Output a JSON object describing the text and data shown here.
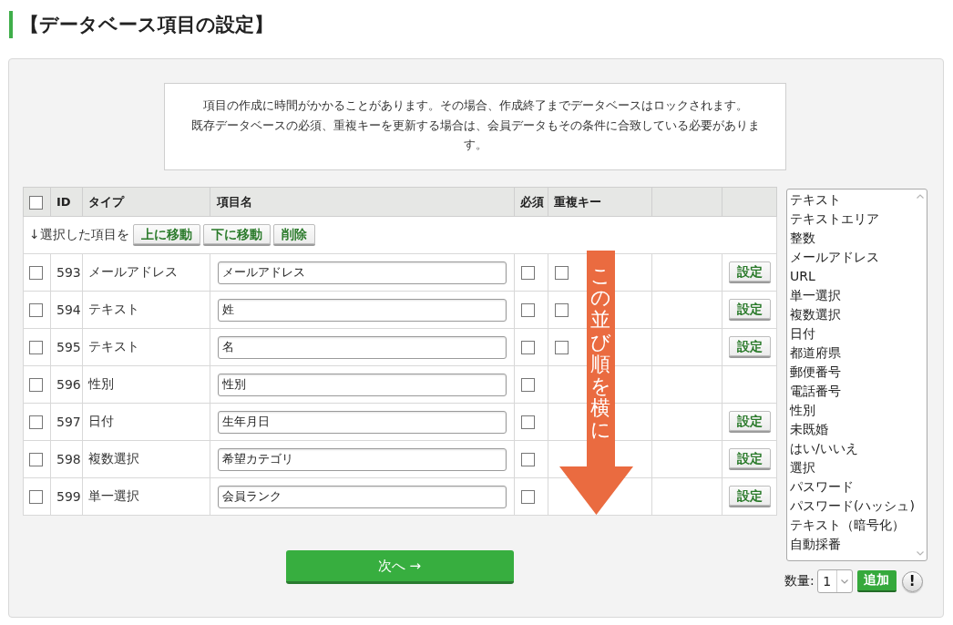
{
  "page_title": "【データベース項目の設定】",
  "notice": {
    "paragraphs": [
      "項目の作成に時間がかかることがあります。その場合、作成終了までデータベースはロックされます。",
      "既存データベースの必須、重複キーを更新する場合は、会員データもその条件に合致している必要があります。"
    ]
  },
  "table": {
    "select_all": {
      "checked": false
    },
    "columns": [
      "ID",
      "タイプ",
      "項目名",
      "必須",
      "重複キー"
    ],
    "bulk_action": {
      "label": "↓選択した項目を",
      "buttons": [
        "上に移動",
        "下に移動",
        "削除"
      ]
    },
    "rows": [
      {
        "checked": false,
        "id": "593",
        "type": "メールアドレス",
        "name": "メールアドレス",
        "required": false,
        "unique_key": false,
        "settings_button": "設定"
      },
      {
        "checked": false,
        "id": "594",
        "type": "テキスト",
        "name": "姓",
        "required": false,
        "unique_key": false,
        "settings_button": "設定"
      },
      {
        "checked": false,
        "id": "595",
        "type": "テキスト",
        "name": "名",
        "required": false,
        "unique_key": false,
        "settings_button": "設定"
      },
      {
        "checked": false,
        "id": "596",
        "type": "性別",
        "name": "性別",
        "required": false
      },
      {
        "checked": false,
        "id": "597",
        "type": "日付",
        "name": "生年月日",
        "required": false,
        "settings_button": "設定"
      },
      {
        "checked": false,
        "id": "598",
        "type": "複数選択",
        "name": "希望カテゴリ",
        "required": false,
        "settings_button": "設定"
      },
      {
        "checked": false,
        "id": "599",
        "type": "単一選択",
        "name": "会員ランク",
        "required": false,
        "settings_button": "設定"
      }
    ]
  },
  "annotation": {
    "text": "この並び順を横に"
  },
  "next_button": "次へ →",
  "type_list": {
    "items": [
      {
        "label": "テキスト",
        "selected": false
      },
      {
        "label": "テキストエリア",
        "selected": false
      },
      {
        "label": "整数",
        "selected": false
      },
      {
        "label": "メールアドレス",
        "selected": false
      },
      {
        "label": "URL",
        "selected": false
      },
      {
        "label": "単一選択",
        "selected": false
      },
      {
        "label": "複数選択",
        "selected": false
      },
      {
        "label": "日付",
        "selected": false
      },
      {
        "label": "都道府県",
        "selected": false
      },
      {
        "label": "郵便番号",
        "selected": false
      },
      {
        "label": "電話番号",
        "selected": false
      },
      {
        "label": "性別",
        "selected": false
      },
      {
        "label": "未既婚",
        "selected": false
      },
      {
        "label": "はい/いいえ",
        "selected": false
      },
      {
        "label": "選択",
        "selected": false
      },
      {
        "label": "パスワード",
        "selected": false
      },
      {
        "label": "パスワード(ハッシュ)",
        "selected": false
      },
      {
        "label": "テキスト（暗号化）",
        "selected": false
      },
      {
        "label": "自動採番",
        "selected": false
      }
    ]
  },
  "quantity": {
    "label": "数量:",
    "value": "1"
  },
  "add_button": "追加",
  "help_button": "!"
}
